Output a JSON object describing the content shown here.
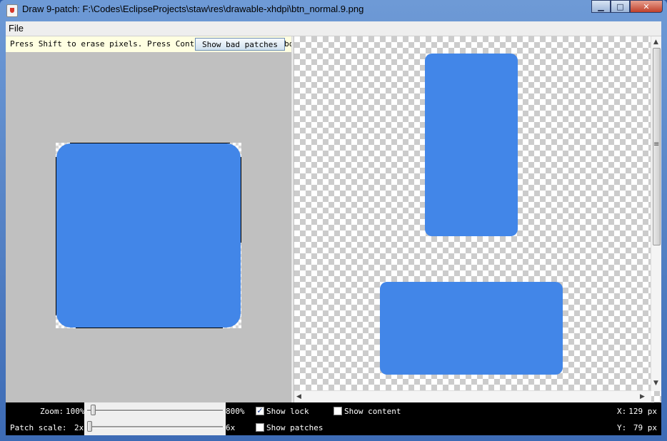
{
  "window": {
    "title": "Draw 9-patch: F:\\Codes\\EclipseProjects\\staw\\res\\drawable-xhdpi\\btn_normal.9.png",
    "minimize": "▁",
    "maximize": "□",
    "close": "✕"
  },
  "menu": {
    "file": "File"
  },
  "editor": {
    "hint": "Press Shift to erase pixels. Press Control to draw layout bounds",
    "show_bad_patches": "Show bad patches"
  },
  "controls": {
    "zoom_label": "Zoom:",
    "zoom_min": "100%",
    "zoom_max": "800%",
    "zoom_value_fraction": 0.03,
    "patch_scale_label": "Patch scale:",
    "patch_scale_min": "2x",
    "patch_scale_max": "6x",
    "patch_scale_value_fraction": 0.0,
    "show_lock": {
      "label": "Show lock",
      "checked": true
    },
    "show_content": {
      "label": "Show content",
      "checked": false
    },
    "show_patches": {
      "label": "Show patches",
      "checked": false
    },
    "x_label": "X:",
    "x_value": "129 px",
    "y_label": "Y:",
    "y_value": "79 px"
  },
  "colors": {
    "patch_fill": "#4286e8",
    "hint_bg": "#ffffe1",
    "status_bar_bg": "#000000"
  },
  "icons": {
    "app": "java-cup-icon",
    "scroll_up": "▲",
    "scroll_down": "▼",
    "scroll_left": "◀",
    "scroll_right": "▶",
    "grip": "≡"
  }
}
